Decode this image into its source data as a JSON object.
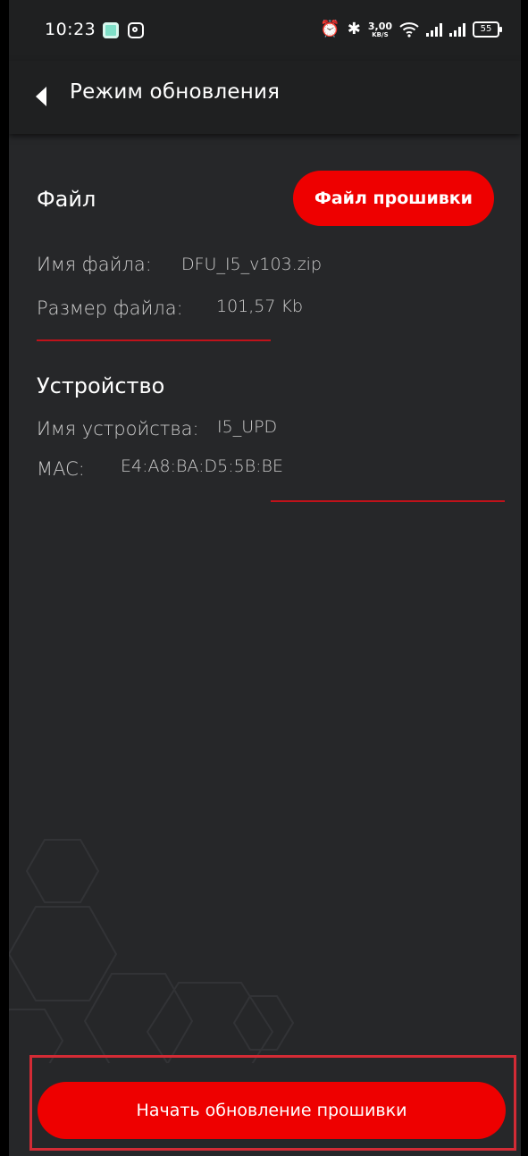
{
  "status_bar": {
    "time": "10:23",
    "speed_value": "3,00",
    "speed_unit": "KB/S",
    "battery": "55",
    "icons": [
      "app-notification-icon",
      "instagram-icon",
      "alarm-icon",
      "bluetooth-icon",
      "wifi-icon",
      "signal-icon",
      "signal-icon",
      "battery-icon"
    ]
  },
  "header": {
    "title": "Режим обновления"
  },
  "file_section": {
    "title": "Файл",
    "button_label": "Файл прошивки",
    "file_name_label": "Имя файла:",
    "file_name_value": "DFU_I5_v103.zip",
    "file_size_label": "Размер файла:",
    "file_size_value": "101,57 Kb"
  },
  "device_section": {
    "title": "Устройство",
    "device_name_label": "Имя устройства:",
    "device_name_value": "I5_UPD",
    "mac_label": "MAC:",
    "mac_value": "E4:A8:BA:D5:5B:BE"
  },
  "actions": {
    "start_update_label": "Начать обновление прошивки"
  },
  "colors": {
    "background": "#262729",
    "bar_background": "#1f2021",
    "accent": "#ee0000",
    "divider": "#c0121a",
    "highlight_frame": "#d32b35"
  }
}
